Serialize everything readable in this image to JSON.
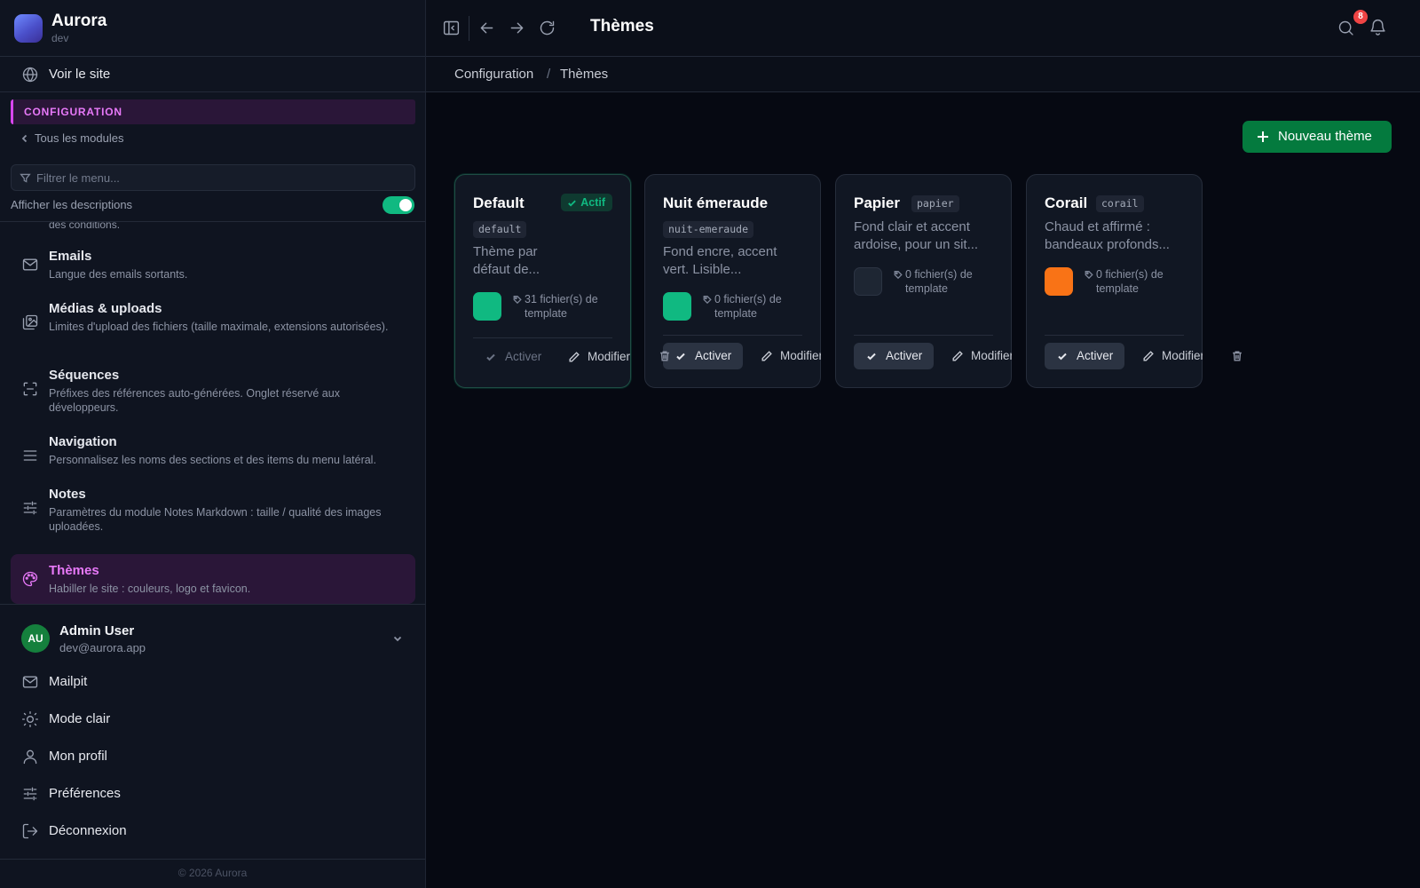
{
  "app": {
    "name": "Aurora",
    "env": "dev"
  },
  "sidebar": {
    "visit_site": "Voir le site",
    "section": "CONFIGURATION",
    "back": "Tous les modules",
    "filter_placeholder": "Filtrer le menu...",
    "show_descriptions": "Afficher les descriptions",
    "show_descriptions_on": true,
    "truncated_desc": "des conditions.",
    "items": [
      {
        "title": "Emails",
        "desc": "Langue des emails sortants.",
        "icon": "mail-icon"
      },
      {
        "title": "Médias & uploads",
        "desc": "Limites d'upload des fichiers (taille maximale, extensions autorisées).",
        "icon": "image-upload-icon"
      },
      {
        "title": "Séquences",
        "desc": "Préfixes des références auto-générées. Onglet réservé aux développeurs.",
        "icon": "scan-icon"
      },
      {
        "title": "Navigation",
        "desc": "Personnalisez les noms des sections et des items du menu latéral.",
        "icon": "menu-lines-icon"
      },
      {
        "title": "Notes",
        "desc": "Paramètres du module Notes Markdown : taille / qualité des images uploadées.",
        "icon": "sliders-icon"
      },
      {
        "title": "Thèmes",
        "desc": "Habiller le site : couleurs, logo et favicon.",
        "icon": "palette-icon",
        "active": true
      }
    ],
    "user": {
      "initials": "AU",
      "name": "Admin User",
      "email": "dev@aurora.app"
    },
    "bottom": [
      {
        "label": "Mailpit",
        "icon": "mail-icon"
      },
      {
        "label": "Mode clair",
        "icon": "sun-icon"
      },
      {
        "label": "Mon profil",
        "icon": "user-icon"
      },
      {
        "label": "Préférences",
        "icon": "sliders-icon"
      },
      {
        "label": "Déconnexion",
        "icon": "logout-icon"
      }
    ],
    "copyright": "© 2026 Aurora"
  },
  "header": {
    "title": "Thèmes",
    "notifications_count": "8",
    "breadcrumb": [
      "Configuration",
      "Thèmes"
    ]
  },
  "main": {
    "new_button": "Nouveau thème",
    "activate_label": "Activer",
    "edit_label": "Modifier",
    "active_label": "Actif",
    "themes": [
      {
        "name": "Default",
        "slug": "default",
        "desc_lines": [
          "Thème par",
          "défaut de..."
        ],
        "color": "#10b981",
        "files_lines": [
          "31 fichier(s) de",
          "template"
        ],
        "active": true
      },
      {
        "name": "Nuit émeraude",
        "slug": "nuit-emeraude",
        "desc_lines": [
          "Fond encre, accent",
          "vert. Lisible..."
        ],
        "color": "#10b981",
        "files_lines": [
          "0 fichier(s) de",
          "template"
        ],
        "active": false
      },
      {
        "name": "Papier",
        "slug": "papier",
        "desc_lines": [
          "Fond clair et accent",
          "ardoise, pour un sit..."
        ],
        "color": "#1e2633",
        "files_lines": [
          "0 fichier(s) de",
          "template"
        ],
        "active": false
      },
      {
        "name": "Corail",
        "slug": "corail",
        "desc_lines": [
          "Chaud et affirmé :",
          "bandeaux profonds..."
        ],
        "color": "#f97316",
        "files_lines": [
          "0 fichier(s) de",
          "template"
        ],
        "active": false
      }
    ]
  },
  "colors": {
    "accent": "#e879f9",
    "primary": "#047a3e",
    "success": "#10b981",
    "badge": "#ef4444"
  }
}
